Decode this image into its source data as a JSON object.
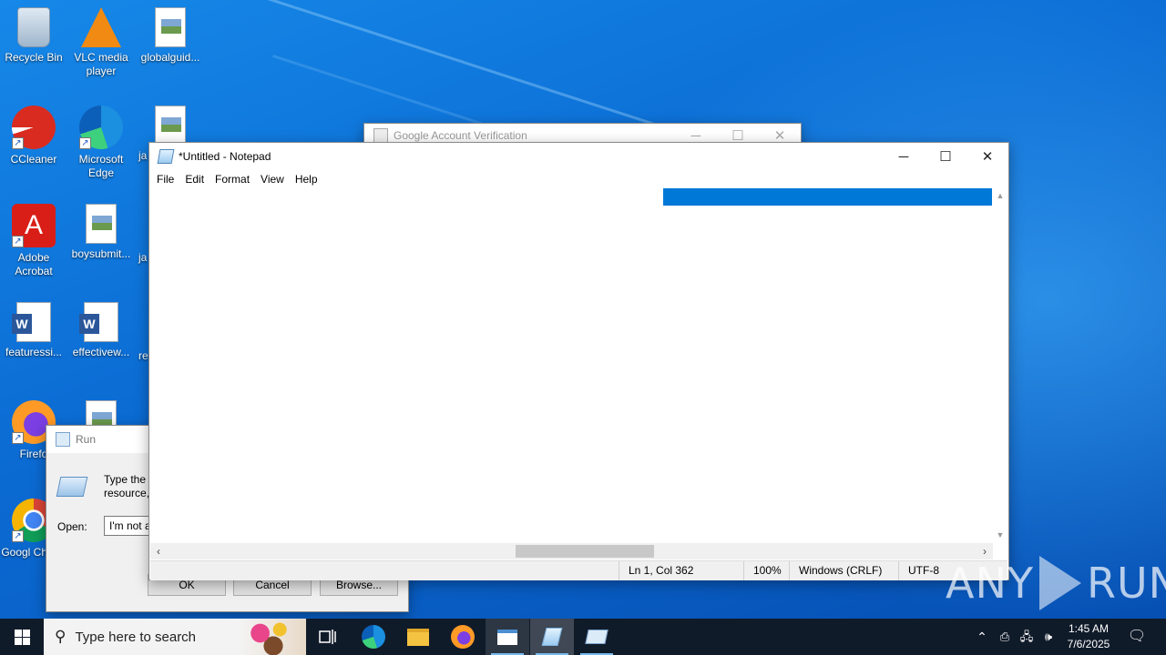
{
  "desktop": {
    "icons": [
      {
        "label": "Recycle Bin"
      },
      {
        "label": "VLC media player"
      },
      {
        "label": "globalguid..."
      },
      {
        "label": "CCleaner"
      },
      {
        "label": "Microsoft Edge"
      },
      {
        "label": "ja"
      },
      {
        "label": "Adobe Acrobat"
      },
      {
        "label": "boysubmit..."
      },
      {
        "label": "ja"
      },
      {
        "label": "featuressi..."
      },
      {
        "label": "effectivew..."
      },
      {
        "label": "re"
      },
      {
        "label": "Firefo"
      },
      {
        "label": "Googl Chrom"
      }
    ]
  },
  "google_window": {
    "title": "Google Account Verification",
    "minimize": "─",
    "maximize": "☐",
    "close": "✕"
  },
  "run_dialog": {
    "title": "Run",
    "description": "Type the resource,",
    "open_label": "Open:",
    "open_value": "I'm not a",
    "ok": "OK",
    "cancel": "Cancel",
    "browse": "Browse..."
  },
  "notepad": {
    "title": "*Untitled - Notepad",
    "minimize": "─",
    "maximize": "☐",
    "close": "✕",
    "menu": [
      "File",
      "Edit",
      "Format",
      "View",
      "Help"
    ],
    "status": {
      "position": "Ln 1, Col 362",
      "zoom": "100%",
      "line_endings": "Windows (CRLF)",
      "encoding": "UTF-8"
    }
  },
  "taskbar": {
    "start_icon": "windows-logo-icon",
    "search_placeholder": "Type here to search",
    "apps": [
      "task-view-icon",
      "edge-icon",
      "file-explorer-icon",
      "firefox-icon",
      "run-app-icon",
      "notepad-icon",
      "run-icon"
    ],
    "clock_time": "1:45 AM",
    "clock_date": "7/6/2025"
  },
  "watermark": {
    "left": "ANY",
    "right": "RUN"
  },
  "colors": {
    "selection": "#0078d7",
    "taskbar": "#101b2a"
  }
}
